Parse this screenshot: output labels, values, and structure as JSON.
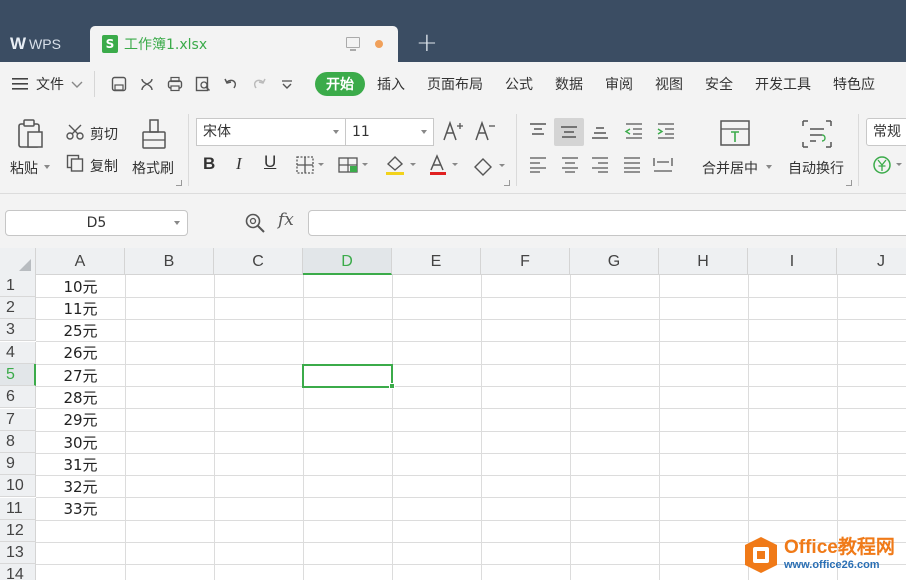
{
  "titlebar": {
    "wps_label": "WPS",
    "doc_tab_title": "工作簿1.xlsx",
    "doc_icon_letter": "S",
    "new_tab_label": "+"
  },
  "menubar": {
    "file_label": "文件",
    "tabs": [
      "开始",
      "插入",
      "页面布局",
      "公式",
      "数据",
      "审阅",
      "视图",
      "安全",
      "开发工具",
      "特色应"
    ]
  },
  "ribbon": {
    "paste_label": "粘贴",
    "cut_label": "剪切",
    "copy_label": "复制",
    "format_painter_label": "格式刷",
    "font_name": "宋体",
    "font_size": "11",
    "merge_center_label": "合并居中",
    "wrap_text_label": "自动换行",
    "number_format": "常规"
  },
  "formulabar": {
    "cell_ref": "D5",
    "fx_label": "fx",
    "formula_value": ""
  },
  "grid": {
    "columns": [
      "A",
      "B",
      "C",
      "D",
      "E",
      "F",
      "G",
      "H",
      "I",
      "J"
    ],
    "active_column": "D",
    "rows": [
      "1",
      "2",
      "3",
      "4",
      "5",
      "6",
      "7",
      "8",
      "9",
      "10",
      "11",
      "12",
      "13",
      "14"
    ],
    "active_row": "5",
    "column_a_values": [
      "10元",
      "11元",
      "25元",
      "26元",
      "27元",
      "28元",
      "29元",
      "30元",
      "31元",
      "32元",
      "33元"
    ]
  },
  "watermark": {
    "line1": "Office教程网",
    "line2": "www.office26.com"
  },
  "colors": {
    "accent": "#3bab4a",
    "titlebar": "#3b4d63",
    "watermark_orange": "#f07a18"
  }
}
